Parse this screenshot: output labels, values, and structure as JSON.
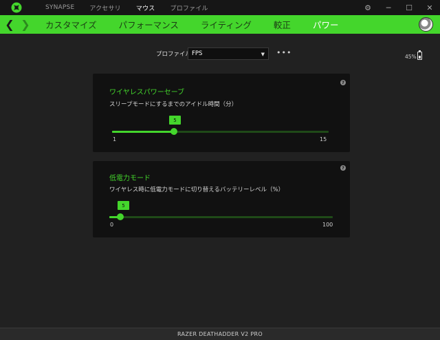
{
  "window": {
    "nav": [
      "SYNAPSE",
      "アクセサリ",
      "マウス",
      "プロファイル"
    ],
    "active_nav": "マウス",
    "controls": [
      "gear-icon",
      "minimize-icon",
      "maximize-icon",
      "close-icon"
    ]
  },
  "tabs": [
    "カスタマイズ",
    "パフォーマンス",
    "ライティング",
    "較正",
    "パワー"
  ],
  "active_tab": "パワー",
  "profile": {
    "label": "プロファイル",
    "value": "FPS",
    "more": "•••"
  },
  "battery": {
    "text": "45%",
    "percent": 45
  },
  "power_saving": {
    "title": "ワイヤレスパワーセーブ",
    "description": "スリープモードにするまでのアイドル時間（分）",
    "value": "5",
    "min": "1",
    "max": "15"
  },
  "low_power": {
    "title": "低電力モード",
    "description": "ワイヤレス時に低電力モードに切り替えるバッテリーレベル（%）",
    "value": "5",
    "min": "0",
    "max": "100"
  },
  "device_name": "RAZER DEATHADDER V2 PRO",
  "colors": {
    "accent": "#44d62c",
    "background": "#212121",
    "card": "#111111"
  }
}
